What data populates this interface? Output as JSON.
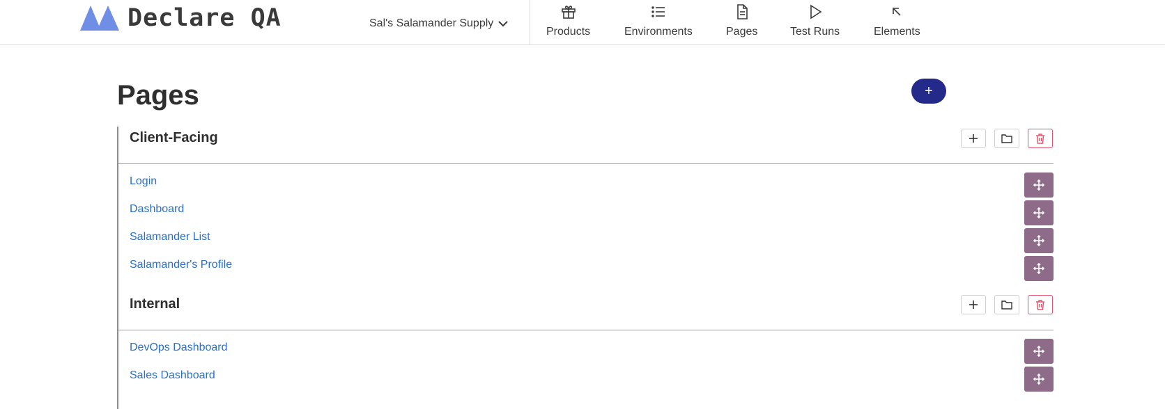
{
  "app": {
    "name": "Declare QA",
    "org": "Sal's Salamander Supply"
  },
  "nav": [
    {
      "label": "Products",
      "icon": "gift-icon"
    },
    {
      "label": "Environments",
      "icon": "list-icon"
    },
    {
      "label": "Pages",
      "icon": "document-icon"
    },
    {
      "label": "Test Runs",
      "icon": "play-icon"
    },
    {
      "label": "Elements",
      "icon": "arrow-up-left-icon"
    }
  ],
  "main": {
    "title": "Pages",
    "add_label": "+"
  },
  "folders": [
    {
      "name": "Client-Facing",
      "pages": [
        "Login",
        "Dashboard",
        "Salamander List",
        "Salamander's Profile"
      ]
    },
    {
      "name": "Internal",
      "pages": [
        "DevOps Dashboard",
        "Sales Dashboard"
      ]
    }
  ],
  "colors": {
    "primary": "#232a8a",
    "move_button": "#8e6b88",
    "link": "#2a6fc9",
    "danger": "#e0526d",
    "logo": "#6f8ee6"
  }
}
